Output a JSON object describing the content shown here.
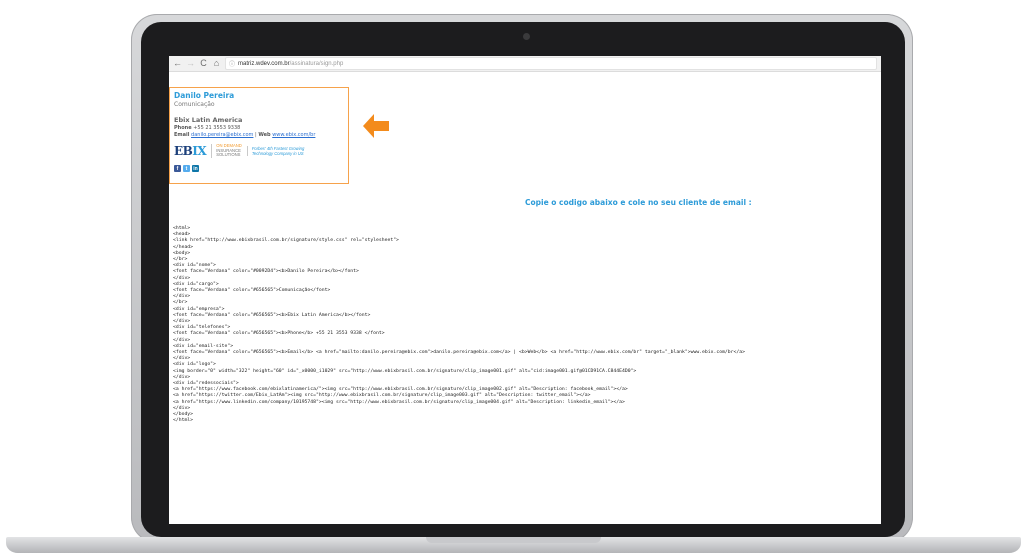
{
  "browser": {
    "back_icon": "←",
    "forward_icon": "→",
    "reload_icon": "C",
    "home_icon": "⌂",
    "info_icon": "ⓘ",
    "url_host": "matriz.wdev.com.br",
    "url_path": "/assinatura/sign.php"
  },
  "signature": {
    "name": "Danilo Pereira",
    "role": "Comunicação",
    "company": "Ebix Latin America",
    "phone_label": "Phone",
    "phone": "+55 21 3553 9338",
    "email_label": "Email",
    "email": "danilo.pereira@ebix.com",
    "separator": "|",
    "web_label": "Web",
    "web": "www.ebix.com/br",
    "logo_text_a": "EB",
    "logo_text_b": "IX",
    "tagline_1": "ON DEMAND",
    "tagline_2": "INSURANCE",
    "tagline_3": "SOLUTIONS",
    "tagline_4": "Forbes' 4th Fastest Growing",
    "tagline_5": "Technology Company in US",
    "social": {
      "facebook": "f",
      "twitter": "t",
      "linkedin": "in"
    }
  },
  "colors": {
    "accent": "#2d9bd8",
    "highlight": "#f6a24b",
    "arrow": "#f38b1c"
  },
  "instruction": "Copie o codigo abaixo e cole no seu cliente de email :",
  "code_lines": [
    "<html>",
    "<head>",
    "<link href=\"http://www.ebixbrasil.com.br/signature/style.css\" rel=\"stylesheet\">",
    "</head>",
    "<body>",
    "</br>",
    "<div id=\"nome\">",
    "<font face=\"Verdana\" color=\"#0092D4\"><b>Danilo Pereira</b></font>",
    "</div>",
    "<div id=\"cargo\">",
    "<font face=\"Verdana\" color=\"#656565\">Comunicação</font>",
    "</div>",
    "</br>",
    "<div id=\"empresa\">",
    "<font face=\"Verdana\" color=\"#656565\"><b>Ebix Latin America</b></font>",
    "</div>",
    "<div id=\"telefones\">",
    "<font face=\"Verdana\" color=\"#656565\"><b>Phone</b> +55 21 3553 9338 </font>",
    "</div>",
    "<div id=\"email-site\">",
    "<font face=\"Verdana\" color=\"#656565\"><b>Email</b> <a href=\"mailto:danilo.pereira@ebix.com\">danilo.pereira@ebix.com</a> | <b>Web</b> <a href=\"http://www.ebix.com/br\" target=\"_blank\">www.ebix.com/br</a>",
    "</div>",
    "<div id=\"logo\">",
    "<img border=\"0\" width=\"322\" height=\"60\" id=\"_x0000_i1029\" src=\"http://www.ebixbrasil.com.br/signature/clip_image001.gif\" alt=\"cid:image001.gif@01CD91CA.C844E4D0\">",
    "</div>",
    "<div id=\"redessociais\">",
    "<a href=\"https://www.facebook.com/ebixlatinamerica/\"><img src=\"http://www.ebixbrasil.com.br/signature/clip_image002.gif\" alt=\"Description: facebook_email\"></a>",
    "<a href=\"https://twitter.com/Ebix_LatAm\"><img src=\"http://www.ebixbrasil.com.br/signature/clip_image003.gif\" alt=\"Description: twitter_email\"></a>",
    "<a href=\"https://www.linkedin.com/company/10195748\"><img src=\"http://www.ebixbrasil.com.br/signature/clip_image004.gif\" alt=\"Description: linkedin_email\"></a>",
    "</div>",
    "</body>",
    "</html>"
  ]
}
